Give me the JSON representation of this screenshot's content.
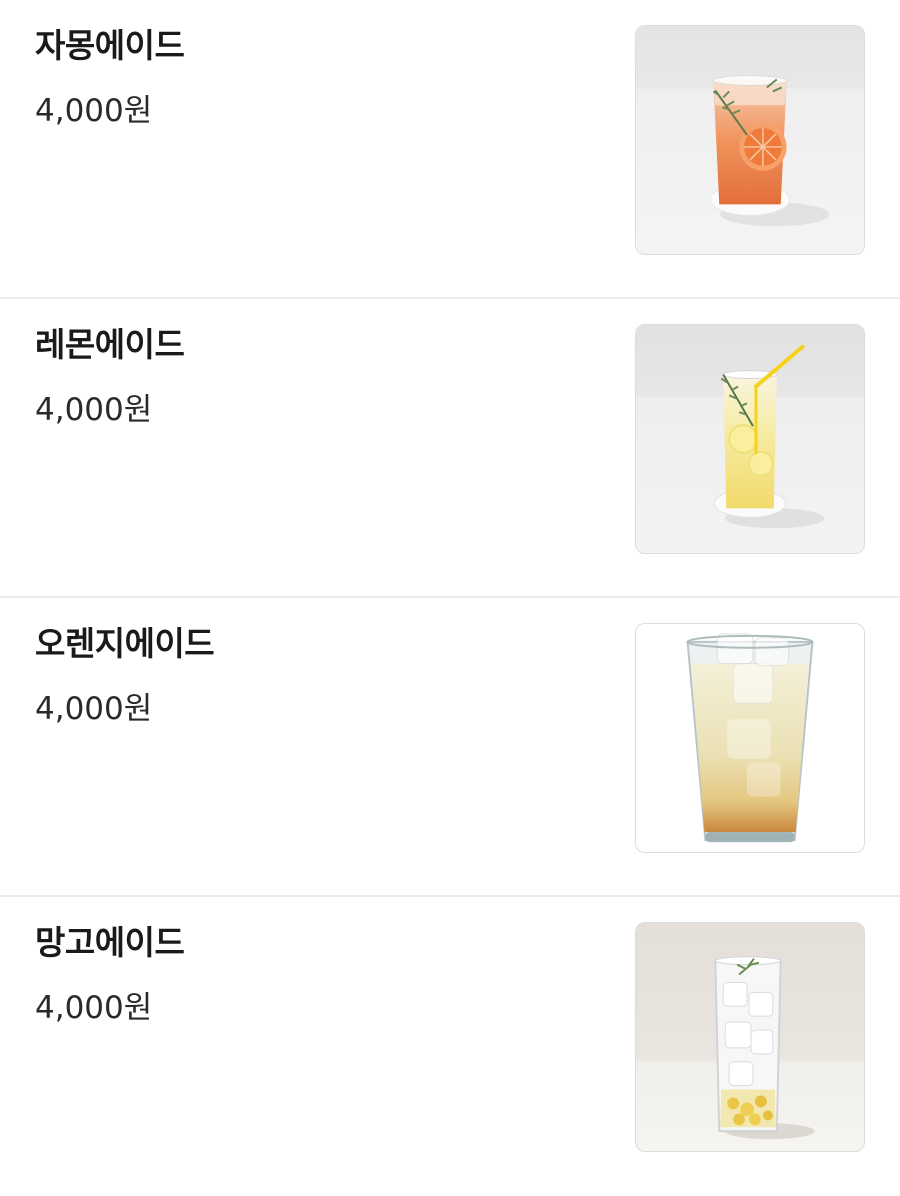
{
  "menu": {
    "items": [
      {
        "name": "자몽에이드",
        "price": "4,000원",
        "image": "grapefruit-ade-photo"
      },
      {
        "name": "레몬에이드",
        "price": "4,000원",
        "image": "lemon-ade-photo"
      },
      {
        "name": "오렌지에이드",
        "price": "4,000원",
        "image": "orange-ade-photo"
      },
      {
        "name": "망고에이드",
        "price": "4,000원",
        "image": "mango-ade-photo"
      }
    ]
  }
}
